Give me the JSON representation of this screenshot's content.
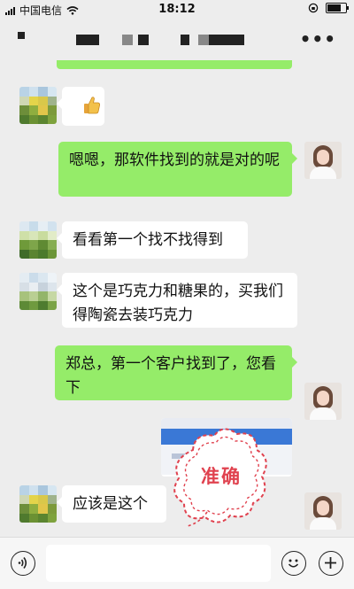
{
  "status_bar": {
    "carrier": "中国电信",
    "time": "18:12"
  },
  "conversation": {
    "messages": [
      {
        "side": "in",
        "type": "emoji",
        "emoji": "thumbs-up"
      },
      {
        "side": "out",
        "type": "text",
        "text": "嗯嗯，那软件找到的就是对的呢"
      },
      {
        "side": "in",
        "type": "text",
        "text": "看看第一个找不找得到"
      },
      {
        "side": "in",
        "type": "text",
        "text": "这个是巧克力和糖果的，买我们得陶瓷去装巧克力"
      },
      {
        "side": "out",
        "type": "text",
        "text": "郑总，第一个客户找到了，您看下"
      },
      {
        "side": "out",
        "type": "image",
        "description": "screenshot"
      },
      {
        "side": "in",
        "type": "text",
        "text": "应该是这个"
      }
    ],
    "annotation": {
      "text": "准确",
      "color": "#e0424f"
    }
  },
  "input_bar": {
    "value": ""
  },
  "colors": {
    "outgoing_bubble": "#95ec69",
    "incoming_bubble": "#ffffff",
    "background": "#ededed"
  }
}
